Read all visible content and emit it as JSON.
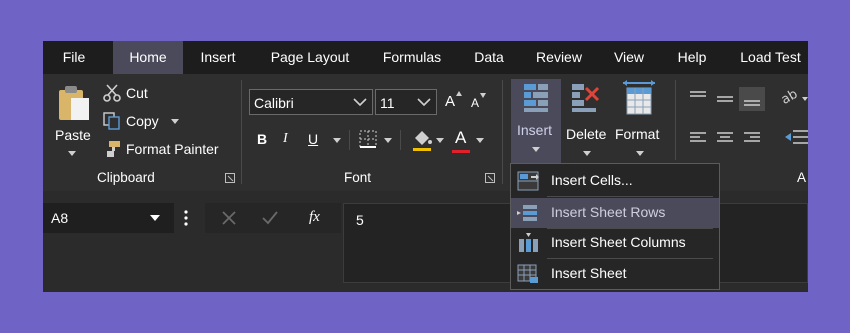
{
  "menubar": {
    "tabs": [
      {
        "label": "File",
        "active": false
      },
      {
        "label": "Home",
        "active": true
      },
      {
        "label": "Insert",
        "active": false
      },
      {
        "label": "Page Layout",
        "active": false
      },
      {
        "label": "Formulas",
        "active": false
      },
      {
        "label": "Data",
        "active": false
      },
      {
        "label": "Review",
        "active": false
      },
      {
        "label": "View",
        "active": false
      },
      {
        "label": "Help",
        "active": false
      },
      {
        "label": "Load Test",
        "active": false
      }
    ]
  },
  "clipboard": {
    "paste_label": "Paste",
    "cut_label": "Cut",
    "copy_label": "Copy",
    "format_painter_label": "Format Painter",
    "group_label": "Clipboard"
  },
  "font": {
    "font_name": "Calibri",
    "font_size": "11",
    "bold": "B",
    "italic": "I",
    "underline": "U",
    "font_color_glyph": "A",
    "grow_glyph": "A",
    "shrink_glyph": "A",
    "group_label": "Font"
  },
  "cells": {
    "insert_label": "Insert",
    "delete_label": "Delete",
    "format_label": "Format"
  },
  "alignment": {
    "group_label_partial": "A"
  },
  "formula_bar": {
    "name_box": "A8",
    "fx_label": "fx",
    "content": "5"
  },
  "insert_menu": {
    "items": [
      {
        "label": "Insert Cells...",
        "highlighted": false
      },
      {
        "label": "Insert Sheet Rows",
        "highlighted": true
      },
      {
        "label": "Insert Sheet Columns",
        "highlighted": false
      },
      {
        "label": "Insert Sheet",
        "highlighted": false
      }
    ]
  },
  "colors": {
    "accent": "#6f64c6",
    "active_tab": "#4b4a5a",
    "icon_blue": "#5b9bd5",
    "icon_red": "#e0453a",
    "font_color_bar": "#e0202a"
  }
}
